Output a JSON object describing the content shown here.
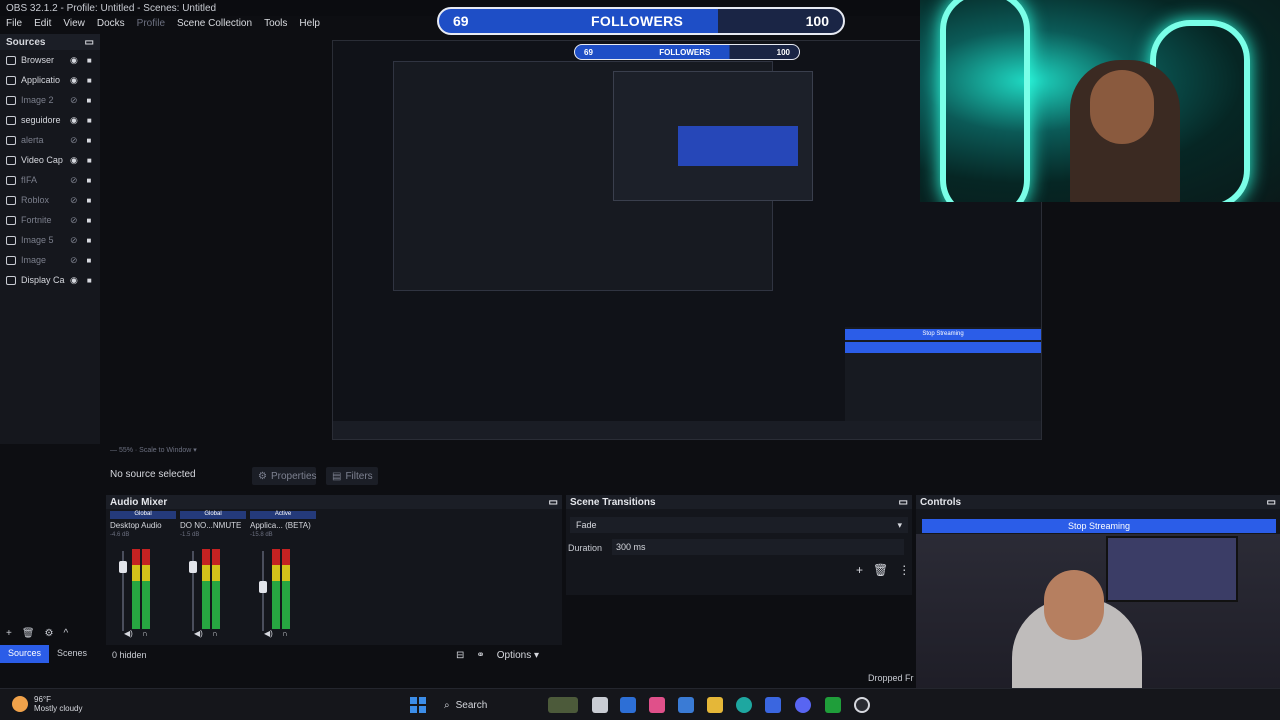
{
  "window": {
    "title": "OBS 32.1.2 - Profile: Untitled - Scenes: Untitled"
  },
  "menu": [
    "File",
    "Edit",
    "View",
    "Docks",
    "Profile",
    "Scene Collection",
    "Tools",
    "Help"
  ],
  "sources": {
    "title": "Sources",
    "items": [
      {
        "label": "Browser",
        "visible": true
      },
      {
        "label": "Applicatio",
        "visible": true
      },
      {
        "label": "Image 2",
        "visible": false
      },
      {
        "label": "seguidore",
        "visible": true
      },
      {
        "label": "alerta",
        "visible": false
      },
      {
        "label": "Video Cap",
        "visible": true
      },
      {
        "label": "fIFA",
        "visible": false
      },
      {
        "label": "Roblox",
        "visible": false
      },
      {
        "label": "Fortnite",
        "visible": false
      },
      {
        "label": "Image 5",
        "visible": false
      },
      {
        "label": "Image",
        "visible": false
      },
      {
        "label": "Display Ca",
        "visible": true
      }
    ]
  },
  "goal": {
    "current": "69",
    "label": "FOLLOWERS",
    "target": "100",
    "progress_fraction": 0.69
  },
  "preview": {
    "status": "No source selected",
    "properties_label": "Properties",
    "filters_label": "Filters"
  },
  "audio_mixer": {
    "title": "Audio Mixer",
    "channels": [
      {
        "badge": "Global",
        "name": "Desktop Audio",
        "db": "-4.6 dB"
      },
      {
        "badge": "Global",
        "name": "DO NO...NMUTE",
        "db": "-1.5 dB"
      },
      {
        "badge": "Active",
        "name": "Applica... (BETA)",
        "db": "-15.8 dB"
      }
    ]
  },
  "tabs": {
    "sources": "Sources",
    "scenes": "Scenes",
    "hidden_count": "0 hidden",
    "options": "Options"
  },
  "transitions": {
    "title": "Scene Transitions",
    "selected": "Fade",
    "duration_label": "Duration",
    "duration_value": "300 ms"
  },
  "controls": {
    "title": "Controls",
    "stop_streaming": "Stop Streaming",
    "dropped": "Dropped Fr"
  },
  "taskbar": {
    "temp": "96°F",
    "weather": "Mostly cloudy",
    "search": "Search"
  },
  "colors": {
    "accent": "#2b5de8",
    "goal_fill": "#1e4ec6"
  }
}
